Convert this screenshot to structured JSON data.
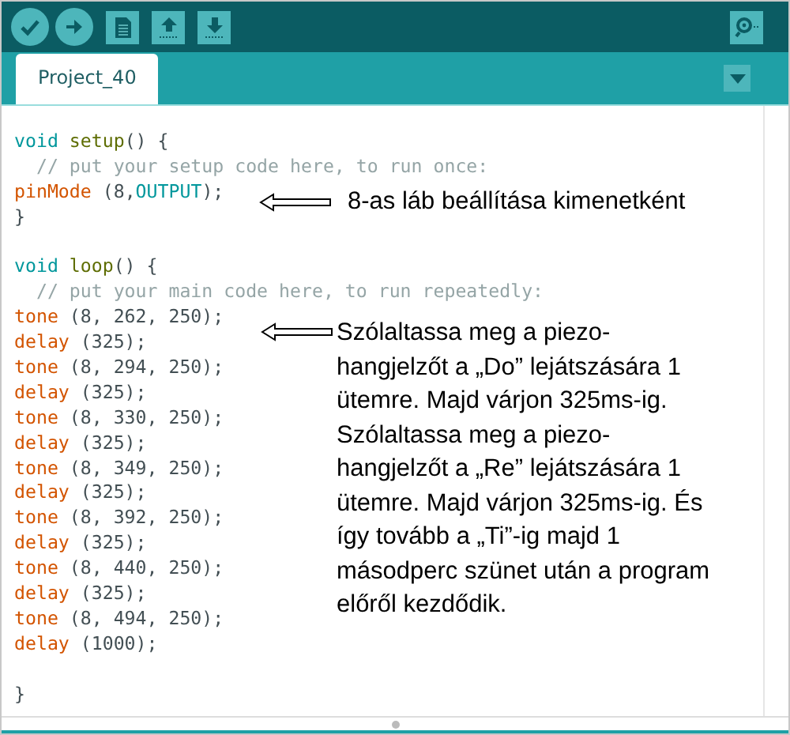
{
  "tabs": [
    {
      "label": "Project_40",
      "selected": true
    }
  ],
  "code_blocks": [
    {
      "lines": [
        [
          {
            "kind": "type",
            "text": "void "
          },
          {
            "kind": "fn",
            "text": "setup"
          },
          {
            "kind": "plain",
            "text": "() {"
          }
        ],
        [
          {
            "kind": "comment",
            "text": "  // put your setup code here, to run once:"
          }
        ],
        [
          {
            "kind": "call",
            "text": "pinMode"
          },
          {
            "kind": "plain",
            "text": " (8,"
          },
          {
            "kind": "const",
            "text": "OUTPUT"
          },
          {
            "kind": "plain",
            "text": ");"
          }
        ],
        [
          {
            "kind": "plain",
            "text": "}"
          }
        ]
      ]
    },
    {
      "lines": [
        [
          {
            "kind": "type",
            "text": "void "
          },
          {
            "kind": "fn",
            "text": "loop"
          },
          {
            "kind": "plain",
            "text": "() {"
          }
        ],
        [
          {
            "kind": "comment",
            "text": "  // put your main code here, to run repeatedly:"
          }
        ],
        [
          {
            "kind": "call",
            "text": "tone"
          },
          {
            "kind": "plain",
            "text": " (8, 262, 250);"
          }
        ],
        [
          {
            "kind": "call",
            "text": "delay"
          },
          {
            "kind": "plain",
            "text": " (325);"
          }
        ],
        [
          {
            "kind": "call",
            "text": "tone"
          },
          {
            "kind": "plain",
            "text": " (8, 294, 250);"
          }
        ],
        [
          {
            "kind": "call",
            "text": "delay"
          },
          {
            "kind": "plain",
            "text": " (325);"
          }
        ],
        [
          {
            "kind": "call",
            "text": "tone"
          },
          {
            "kind": "plain",
            "text": " (8, 330, 250);"
          }
        ],
        [
          {
            "kind": "call",
            "text": "delay"
          },
          {
            "kind": "plain",
            "text": " (325);"
          }
        ],
        [
          {
            "kind": "call",
            "text": "tone"
          },
          {
            "kind": "plain",
            "text": " (8, 349, 250);"
          }
        ],
        [
          {
            "kind": "call",
            "text": "delay"
          },
          {
            "kind": "plain",
            "text": " (325);"
          }
        ],
        [
          {
            "kind": "call",
            "text": "tone"
          },
          {
            "kind": "plain",
            "text": " (8, 392, 250);"
          }
        ],
        [
          {
            "kind": "call",
            "text": "delay"
          },
          {
            "kind": "plain",
            "text": " (325);"
          }
        ],
        [
          {
            "kind": "call",
            "text": "tone"
          },
          {
            "kind": "plain",
            "text": " (8, 440, 250);"
          }
        ],
        [
          {
            "kind": "call",
            "text": "delay"
          },
          {
            "kind": "plain",
            "text": " (325);"
          }
        ],
        [
          {
            "kind": "call",
            "text": "tone"
          },
          {
            "kind": "plain",
            "text": " (8, 494, 250);"
          }
        ],
        [
          {
            "kind": "call",
            "text": "delay"
          },
          {
            "kind": "plain",
            "text": " (1000);"
          }
        ]
      ]
    },
    {
      "lines": [
        [
          {
            "kind": "plain",
            "text": "}"
          }
        ]
      ]
    }
  ],
  "annotations": [
    {
      "lines": [
        "8-as láb beállítása kimenetként"
      ]
    },
    {
      "lines": [
        "Szólaltassa meg a piezo-",
        "hangjelzőt a „Do” lejátszására 1",
        "ütemre. Majd várjon 325ms-ig.",
        "Szólaltassa meg a piezo-",
        "hangjelzőt a „Re” lejátszására 1",
        "ütemre. Majd várjon 325ms-ig. És",
        "így tovább a „Ti”-ig majd 1",
        "másodperc szünet után a program",
        "előről kezdődik."
      ]
    }
  ]
}
